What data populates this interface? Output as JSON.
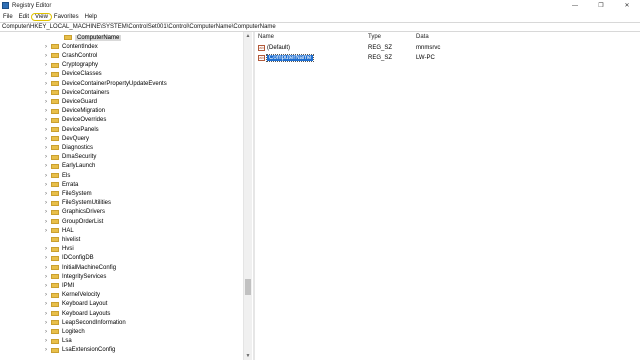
{
  "window": {
    "title": "Registry Editor",
    "controls": [
      "—",
      "❐",
      "✕"
    ]
  },
  "menu": [
    "File",
    "Edit",
    "View",
    "Favorites",
    "Help"
  ],
  "address": "Computer\\HKEY_LOCAL_MACHINE\\SYSTEM\\ControlSet001\\Control\\ComputerName\\ComputerName",
  "tree": [
    {
      "label": "ComputerName",
      "expandable": false,
      "selected": true,
      "indent": 1
    },
    {
      "label": "ContentIndex",
      "expandable": true
    },
    {
      "label": "CrashControl",
      "expandable": true
    },
    {
      "label": "Cryptography",
      "expandable": true
    },
    {
      "label": "DeviceClasses",
      "expandable": true
    },
    {
      "label": "DeviceContainerPropertyUpdateEvents",
      "expandable": true
    },
    {
      "label": "DeviceContainers",
      "expandable": true
    },
    {
      "label": "DeviceGuard",
      "expandable": true
    },
    {
      "label": "DeviceMigration",
      "expandable": true
    },
    {
      "label": "DeviceOverrides",
      "expandable": true
    },
    {
      "label": "DevicePanels",
      "expandable": true
    },
    {
      "label": "DevQuery",
      "expandable": true
    },
    {
      "label": "Diagnostics",
      "expandable": true
    },
    {
      "label": "DmaSecurity",
      "expandable": true
    },
    {
      "label": "EarlyLaunch",
      "expandable": true
    },
    {
      "label": "Els",
      "expandable": true
    },
    {
      "label": "Errata",
      "expandable": true
    },
    {
      "label": "FileSystem",
      "expandable": true
    },
    {
      "label": "FileSystemUtilities",
      "expandable": true
    },
    {
      "label": "GraphicsDrivers",
      "expandable": true
    },
    {
      "label": "GroupOrderList",
      "expandable": true
    },
    {
      "label": "HAL",
      "expandable": true
    },
    {
      "label": "hivelist",
      "expandable": false
    },
    {
      "label": "Hvsi",
      "expandable": true
    },
    {
      "label": "IDConfigDB",
      "expandable": true
    },
    {
      "label": "InitialMachineConfig",
      "expandable": true
    },
    {
      "label": "IntegrityServices",
      "expandable": true
    },
    {
      "label": "IPMI",
      "expandable": true
    },
    {
      "label": "KernelVelocity",
      "expandable": true
    },
    {
      "label": "Keyboard Layout",
      "expandable": true
    },
    {
      "label": "Keyboard Layouts",
      "expandable": true
    },
    {
      "label": "LeapSecondInformation",
      "expandable": true
    },
    {
      "label": "Logitech",
      "expandable": true
    },
    {
      "label": "Lsa",
      "expandable": true
    },
    {
      "label": "LsaExtensionConfig",
      "expandable": true
    }
  ],
  "values_pane": {
    "columns": {
      "name": "Name",
      "type": "Type",
      "data": "Data"
    },
    "rows": [
      {
        "name": "(Default)",
        "type": "REG_SZ",
        "data": "mnmsrvc",
        "selected": false
      },
      {
        "name": "ComputerName",
        "type": "REG_SZ",
        "data": "LW-PC",
        "selected": true
      }
    ]
  },
  "scrollbar": {
    "up_arrow": "▲",
    "down_arrow": "▼"
  },
  "icons": {
    "app": "registry-icon",
    "folder": "folder-icon",
    "string_value": "string-value-icon",
    "expand": "chevron-right-icon"
  },
  "colors": {
    "selection": "#1f6fd1",
    "folder": "#e8bf4a",
    "menu_highlight": "#e0c200"
  }
}
